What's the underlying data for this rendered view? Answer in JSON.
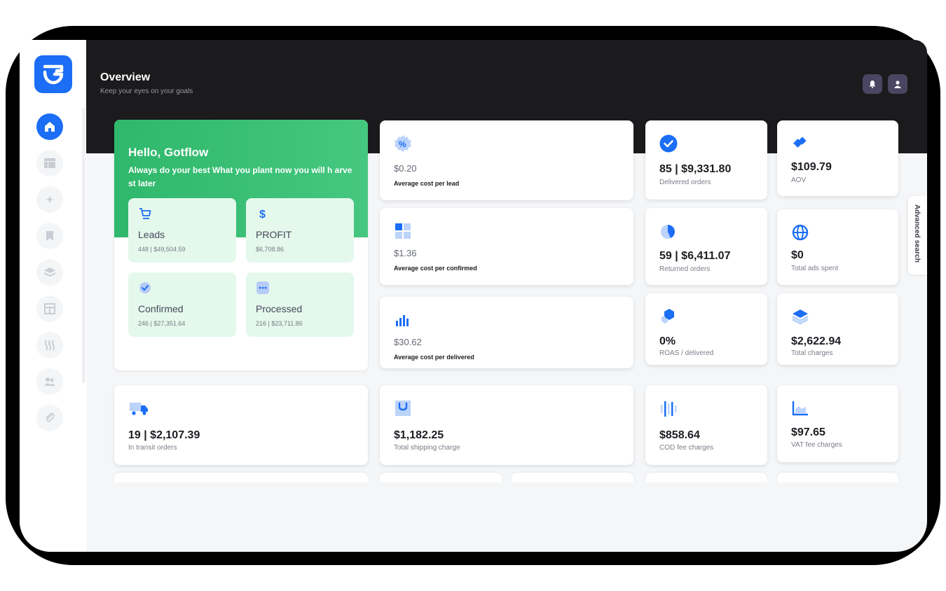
{
  "header": {
    "title": "Overview",
    "subtitle": "Keep your eyes on your goals"
  },
  "sidebar": {
    "items": [
      {
        "icon": "home-icon"
      },
      {
        "icon": "layout-icon"
      },
      {
        "icon": "sparkle-icon"
      },
      {
        "icon": "bookmark-icon"
      },
      {
        "icon": "layers-icon"
      },
      {
        "icon": "table-icon"
      },
      {
        "icon": "waves-icon"
      },
      {
        "icon": "users-icon"
      },
      {
        "icon": "paperclip-icon"
      }
    ]
  },
  "welcome": {
    "heading": "Hello, Gotflow",
    "message": "Always do your best What you plant now you will h arvest later",
    "tiles": [
      {
        "label": "Leads",
        "value": "448 | $49,504.59",
        "icon": "cart-icon"
      },
      {
        "label": "PROFIT",
        "value": "$6,708.86",
        "icon": "dollar-icon"
      },
      {
        "label": "Confirmed",
        "value": "246 | $27,351.64",
        "icon": "check-circle-icon"
      },
      {
        "label": "Processed",
        "value": "216 | $23,711.86",
        "icon": "dots-icon"
      }
    ]
  },
  "cost_cards": [
    {
      "value": "$0.20",
      "label": "Average cost per lead",
      "icon": "percent-badge-icon"
    },
    {
      "value": "$1.36",
      "label": "Average cost per confirmed",
      "icon": "grid-icon"
    },
    {
      "value": "$30.62",
      "label": "Average cost per delivered",
      "icon": "bar-chart-icon"
    }
  ],
  "stat_cards": [
    {
      "value": "85 | $9,331.80",
      "label": "Delivered orders",
      "icon": "check-badge-icon"
    },
    {
      "value": "$109.79",
      "label": "AOV",
      "icon": "diamond-icon"
    },
    {
      "value": "59 | $6,411.07",
      "label": "Returned orders",
      "icon": "pie-chart-icon"
    },
    {
      "value": "$0",
      "label": "Total ads spent",
      "icon": "globe-icon"
    },
    {
      "value": "0%",
      "label": "ROAS / delivered",
      "icon": "cube-icon"
    },
    {
      "value": "$2,622.94",
      "label": "Total charges",
      "icon": "stack-icon"
    }
  ],
  "bottom_cards": [
    {
      "value": "19 | $2,107.39",
      "label": "In transit orders",
      "icon": "truck-icon"
    },
    {
      "value": "$1,182.25",
      "label": "Total shipping charge",
      "icon": "shopping-bag-icon"
    },
    {
      "value": "$858.64",
      "label": "COD fee charges",
      "icon": "signal-bars-icon"
    },
    {
      "value": "$97.65",
      "label": "VAT fee charges",
      "icon": "area-chart-icon"
    }
  ],
  "advanced_search": {
    "label": "Advanced search"
  },
  "colors": {
    "accent": "#1b6ef5",
    "green": "#3cc07a",
    "dark": "#1b1b1d"
  }
}
